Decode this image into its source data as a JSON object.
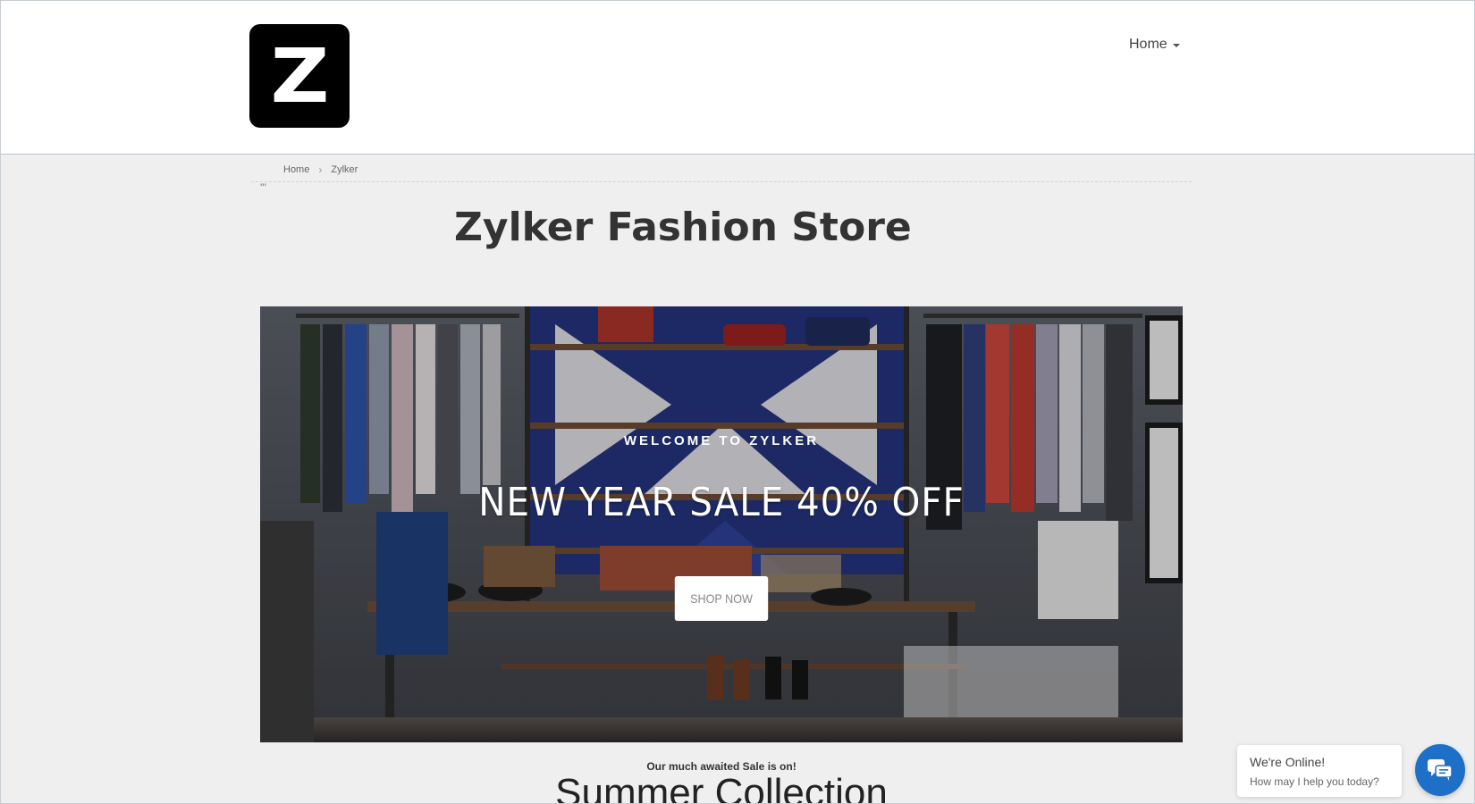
{
  "header": {
    "logo_letter": "Z",
    "nav_home_label": "Home"
  },
  "breadcrumb": {
    "items": [
      "Home",
      "Zylker"
    ],
    "separator": "›"
  },
  "stray_text": "'''",
  "page_title": "Zylker Fashion Store",
  "hero": {
    "eyebrow": "WELCOME TO ZYLKER",
    "headline": "NEW YEAR SALE 40% OFF",
    "cta_label": "SHOP NOW"
  },
  "sale_note": "Our much awaited Sale is on!",
  "collection_title": "Summer Collection",
  "chat": {
    "title": "We're Online!",
    "subtitle": "How may I help you today?",
    "icon": "chat-icon",
    "color": "#1e6fc7"
  }
}
